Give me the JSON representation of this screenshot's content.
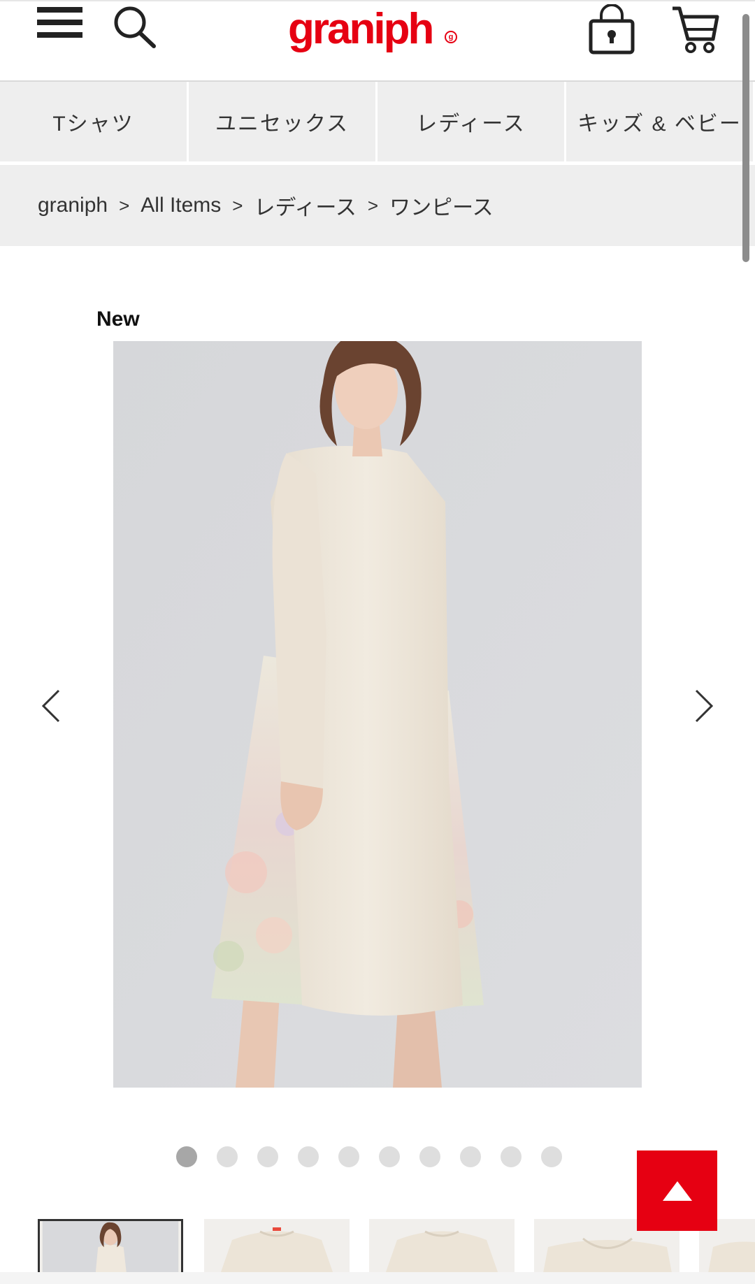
{
  "header": {
    "logo_text": "graniph",
    "logo_mark": "g",
    "brand_color": "#e60012",
    "icons": [
      "menu-icon",
      "search-icon",
      "lock-icon",
      "cart-icon"
    ]
  },
  "category_nav": {
    "tabs": [
      {
        "label": "Tシャツ"
      },
      {
        "label": "ユニセックス"
      },
      {
        "label": "レディース"
      },
      {
        "label": "キッズ & ベビー"
      }
    ]
  },
  "breadcrumb": {
    "items": [
      "graniph",
      "All Items",
      "レディース",
      "ワンピース"
    ],
    "separator": ">"
  },
  "product": {
    "badge": "New",
    "carousel": {
      "total_images": 10,
      "current_index": 1
    },
    "thumbnails_visible": 5
  },
  "controls": {
    "back_to_top_icon": "triangle-up-icon",
    "prev_icon": "chevron-left-icon",
    "next_icon": "chevron-right-icon"
  }
}
